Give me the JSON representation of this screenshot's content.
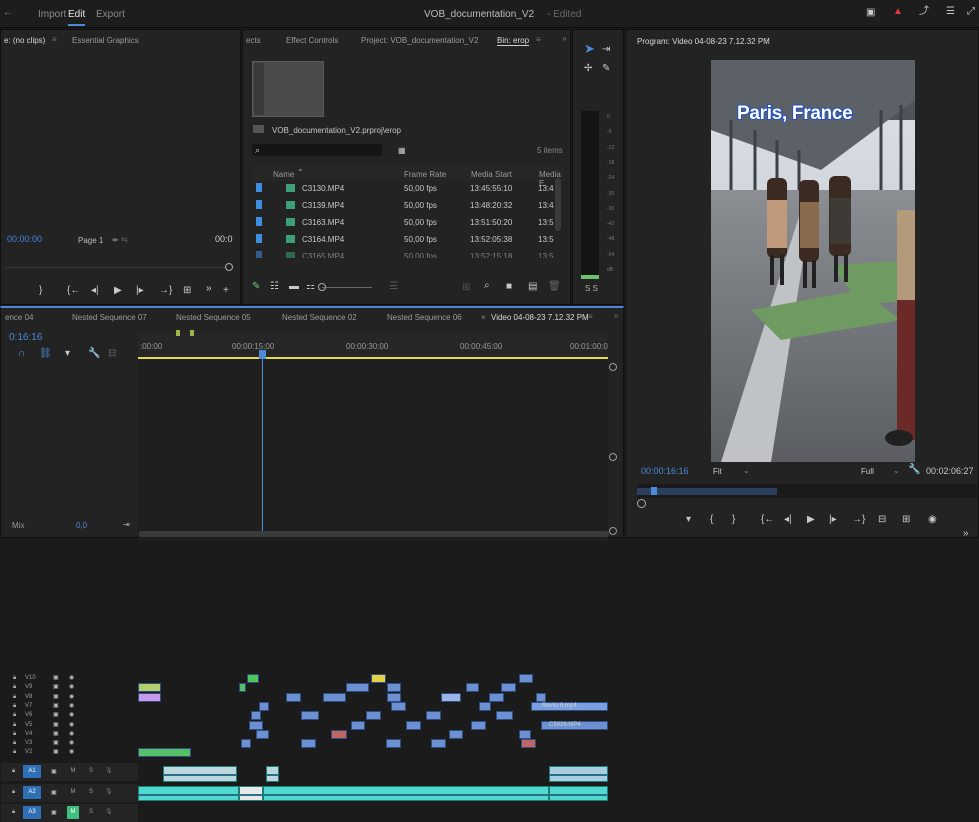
{
  "topbar": {
    "menus": [
      "Import",
      "Edit",
      "Export"
    ],
    "project_title": "VOB_documentation_V2",
    "edited_suffix": "- Edited"
  },
  "effects_panel": {
    "tab_source": "e: (no clips)",
    "tab_graphics": "Essential Graphics",
    "timecode": "00:00:00",
    "page": "Page 1",
    "timecode_right": "00:0"
  },
  "project_panel": {
    "tabs": [
      "ects",
      "Effect Controls",
      "Project: VOB_documentation_V2",
      "Bin: erop"
    ],
    "path": "VOB_documentation_V2.prproj\\erop",
    "item_count": "5 items",
    "columns": [
      "Name",
      "Frame Rate",
      "Media Start",
      "Media E"
    ],
    "rows": [
      {
        "name": "C3130.MP4",
        "rate": "50,00 fps",
        "start": "13:45:55:10",
        "end": "13:4"
      },
      {
        "name": "C3139.MP4",
        "rate": "50,00 fps",
        "start": "13:48:20:32",
        "end": "13:4"
      },
      {
        "name": "C3163.MP4",
        "rate": "50,00 fps",
        "start": "13:51:50:20",
        "end": "13:5"
      },
      {
        "name": "C3164.MP4",
        "rate": "50,00 fps",
        "start": "13:52:05:38",
        "end": "13:5"
      },
      {
        "name": "C3165.MP4",
        "rate": "50,00 fps",
        "start": "13:52:15:18",
        "end": "13:5"
      }
    ]
  },
  "meter": {
    "ticks": [
      "0",
      "-6",
      "-12",
      "-18",
      "-24",
      "-30",
      "-36",
      "-42",
      "-48",
      "-54",
      "dB"
    ],
    "solo": "S S"
  },
  "program": {
    "title": "Program: Video 04-08-23 7.12.32 PM",
    "overlay_text": "Paris, France",
    "timecode": "00:00:16:16",
    "fit": "Fit",
    "quality": "Full",
    "duration": "00:02:06:27"
  },
  "timeline": {
    "tabs": [
      "ence 04",
      "Nested Sequence 07",
      "Nested Sequence 05",
      "Nested Sequence 02",
      "Nested Sequence 06",
      "Video 04-08-23 7.12.32 PM"
    ],
    "timecode": "0:16:16",
    "ruler": [
      ":00:00",
      "00:00:15:00",
      "00:00:30:00",
      "00:00:45:00",
      "00:01:00:0"
    ],
    "video_tracks": [
      "V10",
      "V9",
      "V8",
      "V7",
      "V6",
      "V5",
      "V4",
      "V3",
      "V2"
    ],
    "audio_tracks": [
      "A1",
      "A2",
      "A3"
    ],
    "mix_label": "Mix",
    "mix_value": "0,0",
    "clip_labels": [
      "Revisi 6.mp4",
      "C5926.MP4"
    ]
  },
  "colors": {
    "accent": "#4b8ad8",
    "audio": "#4fd9cf",
    "video_clip": "#6d90d2"
  }
}
